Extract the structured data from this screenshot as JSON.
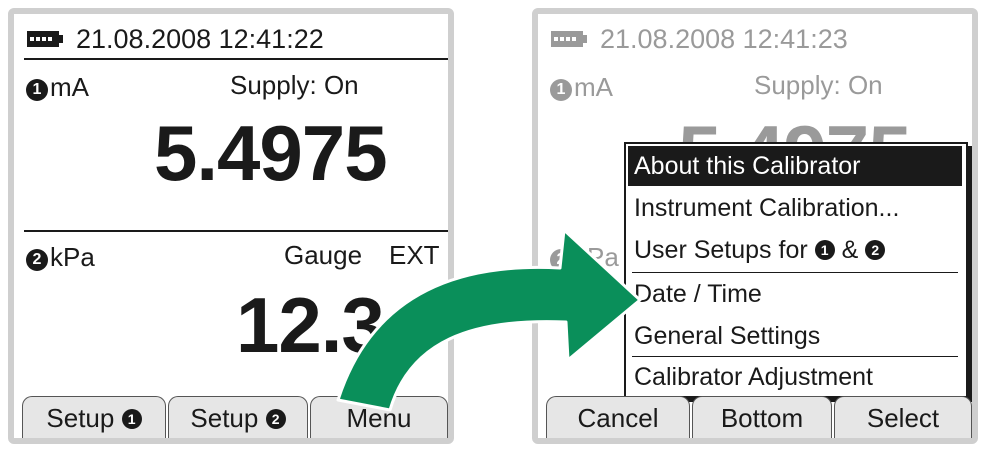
{
  "left_screen": {
    "datetime": "21.08.2008  12:41:22",
    "ch1": {
      "badge": "1",
      "unit": "mA",
      "status": "Supply: On",
      "value": "5.4975"
    },
    "ch2": {
      "badge": "2",
      "unit": "kPa",
      "mode": "Gauge",
      "ext": "EXT",
      "value": "12.3"
    },
    "softkeys": {
      "setup1": "Setup",
      "setup1_badge": "1",
      "setup2": "Setup",
      "setup2_badge": "2",
      "menu": "Menu"
    }
  },
  "right_screen": {
    "datetime": "21.08.2008  12:41:23",
    "ch1": {
      "badge": "1",
      "unit": "mA",
      "status": "Supply: On",
      "value_partial": "5.4975"
    },
    "ch2": {
      "badge": "2",
      "unit": "kPa"
    },
    "menu": {
      "items": [
        {
          "label": "About this Calibrator",
          "selected": true
        },
        {
          "label": "Instrument Calibration...",
          "selected": false
        },
        {
          "label": "User Setups for",
          "badge1": "1",
          "amp": "&",
          "badge2": "2",
          "selected": false
        },
        {
          "label": "Date / Time",
          "selected": false
        },
        {
          "label": "General Settings",
          "selected": false
        },
        {
          "label": "Calibrator Adjustment",
          "selected": false
        }
      ]
    },
    "softkeys": {
      "cancel": "Cancel",
      "bottom": "Bottom",
      "select": "Select"
    }
  },
  "colors": {
    "arrow": "#0a8f5a",
    "bezel": "#cfcfcf",
    "softkey": "#e6e6e6",
    "dim_text": "#9a9a9a"
  }
}
